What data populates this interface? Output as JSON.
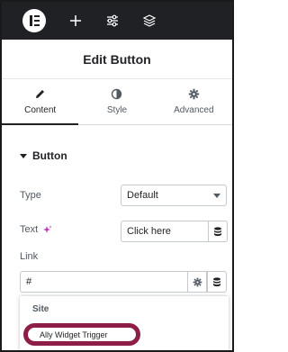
{
  "topbar": {
    "icons": [
      "elementor-logo-icon",
      "plus-icon",
      "sliders-icon",
      "layers-icon"
    ]
  },
  "header": {
    "title": "Edit Button"
  },
  "tabs": [
    {
      "label": "Content",
      "icon": "pencil-icon",
      "active": true
    },
    {
      "label": "Style",
      "icon": "half-circle-icon",
      "active": false
    },
    {
      "label": "Advanced",
      "icon": "gear-icon",
      "active": false
    }
  ],
  "section": {
    "title": "Button"
  },
  "fields": {
    "type": {
      "label": "Type",
      "value": "Default"
    },
    "text": {
      "label": "Text",
      "value": "Click here"
    },
    "link": {
      "label": "Link",
      "value": "#"
    }
  },
  "dropdown": {
    "group": "Site",
    "item": "Ally Widget Trigger"
  },
  "colors": {
    "topbar": "#1f2124",
    "highlight": "#8c1e48",
    "ai": "#c038c0"
  }
}
